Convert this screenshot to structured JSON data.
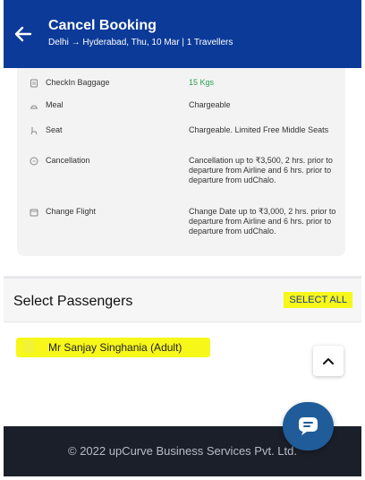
{
  "header": {
    "title": "Cancel Booking",
    "subtitle": "Delhi → Hyderabad, Thu, 10 Mar | 1 Travellers"
  },
  "details": [
    {
      "icon": "baggage-icon",
      "label": "CheckIn Baggage",
      "value": "15 Kgs",
      "color": "#2ca24a"
    },
    {
      "icon": "meal-icon",
      "label": "Meal",
      "value": "Chargeable"
    },
    {
      "icon": "seat-icon",
      "label": "Seat",
      "value": "Chargeable. Limited Free Middle Seats"
    },
    {
      "icon": "cancellation-icon",
      "label": "Cancellation",
      "value": "Cancellation up to ₹3,500, 2 hrs. prior to departure from Airline and 6 hrs. prior to departure from udChalo."
    },
    {
      "icon": "change-flight-icon",
      "label": "Change Flight",
      "value": "Change Date up to ₹3,000, 2 hrs. prior to departure from Airline and 6 hrs. prior to departure from udChalo."
    }
  ],
  "passengers_section": {
    "title": "Select Passengers",
    "select_all": "SELECT ALL"
  },
  "passenger": {
    "name": "Mr Sanjay Singhania (Adult)"
  },
  "footer": {
    "copyright": "© 2022 upCurve Business Services Pvt. Ltd."
  },
  "colors": {
    "header_bg": "#0b3a98",
    "highlight": "#f7f71a",
    "footer_bg": "#1b1f2a",
    "green": "#2ca24a"
  }
}
